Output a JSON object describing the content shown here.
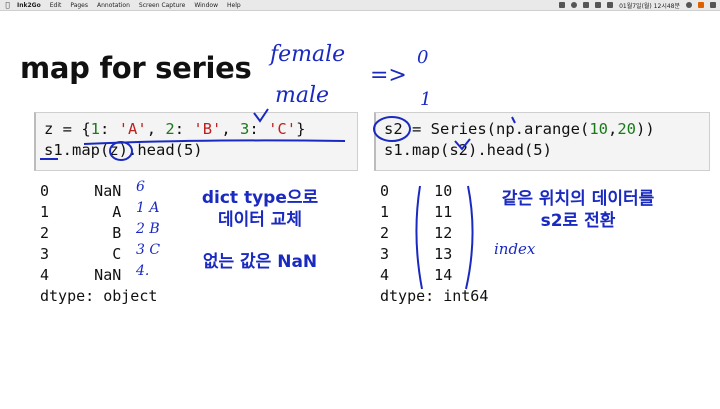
{
  "menubar": {
    "app_name": "Ink2Go",
    "items": [
      "Edit",
      "Pages",
      "Annotation",
      "Screen Capture",
      "Window",
      "Help"
    ],
    "clock": "01월7일(월) 12시48분"
  },
  "slide": {
    "title": "map for series",
    "left_code": {
      "line1": [
        "z = {",
        "1",
        ": ",
        "'A'",
        ", ",
        "2",
        ": ",
        "'B'",
        ", ",
        "3",
        ": ",
        "'C'",
        "}"
      ],
      "line2": "s1.map(z).head(5)"
    },
    "right_code": {
      "line1": [
        "s2 = Series(np.arange(",
        "10",
        ",",
        "20",
        "))"
      ],
      "line2": "s1.map(s2).head(5)"
    },
    "left_output": {
      "rows": [
        "0     NaN",
        "1       A",
        "2       B",
        "3       C",
        "4     NaN"
      ],
      "dtype": "dtype: object"
    },
    "right_output": {
      "rows": [
        "0     10",
        "1     11",
        "2     12",
        "3     13",
        "4     14"
      ],
      "dtype": "dtype: int64"
    },
    "notes": {
      "left_1_line1": "dict type으로",
      "left_1_line2": "데이터 교체",
      "left_2": "없는 값은 NaN",
      "right_line1": "같은 위치의 데이터를",
      "right_line2": "s2로 전환"
    },
    "handwriting": {
      "female": "female",
      "male": "male",
      "arrow": "=>",
      "zero": "0",
      "one": "1",
      "index": "index",
      "annot_col": [
        "6",
        "1 A",
        "2 B",
        "3 C",
        "4."
      ]
    },
    "colors": {
      "ink": "#1a2ac0",
      "string": "#b22222",
      "number": "#1a7a1a"
    }
  }
}
